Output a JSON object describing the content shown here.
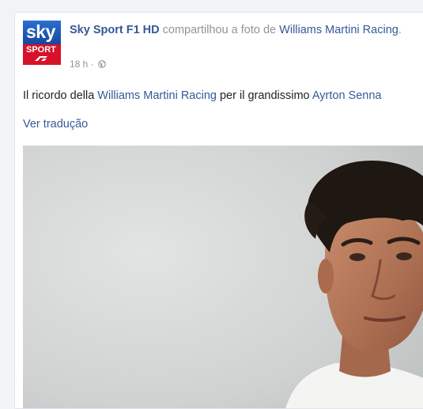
{
  "post": {
    "page_name": "Sky Sport F1 HD",
    "action_text": " compartilhou a foto de ",
    "shared_from": "Williams Martini Racing",
    "action_end": ".",
    "time": "18 h",
    "separator": "·",
    "privacy_icon": "globe-icon",
    "avatar": {
      "logo_line1": "sky",
      "logo_line2": "SPORT"
    },
    "text": {
      "part1": "Il ricordo della ",
      "mention1": "Williams Martini Racing",
      "part2": " per il grandissimo ",
      "mention2": "Ayrton Senna"
    },
    "translate_label": "Ver tradução",
    "photo": {
      "subject": "portrait-photo"
    }
  },
  "colors": {
    "link": "#365899",
    "text": "#1d2129",
    "meta": "#90949c",
    "sky_blue": "#17469a",
    "sport_red": "#d6112a"
  }
}
